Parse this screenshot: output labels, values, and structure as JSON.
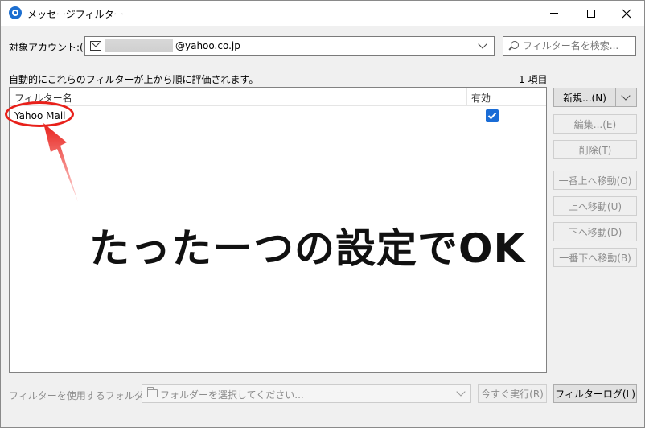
{
  "window": {
    "title": "メッセージフィルター"
  },
  "account": {
    "label": "対象アカウント:(F)",
    "value": "@yahoo.co.jp"
  },
  "search": {
    "placeholder": "フィルター名を検索..."
  },
  "list": {
    "description": "自動的にこれらのフィルターが上から順に評価されます。",
    "count": "1 項目",
    "columns": {
      "name": "フィルター名",
      "enabled": "有効"
    },
    "rows": [
      {
        "name": "Yahoo Mail",
        "enabled": true
      }
    ]
  },
  "buttons": {
    "new": "新規...(N)",
    "edit": "編集...(E)",
    "delete": "削除(T)",
    "move_top": "一番上へ移動(O)",
    "move_up": "上へ移動(U)",
    "move_down": "下へ移動(D)",
    "move_bottom": "一番下へ移動(B)",
    "run_now": "今すぐ実行(R)",
    "filter_log": "フィルターログ(L)"
  },
  "footer": {
    "folder_label": "フィルターを使用するフォルダー:(C)",
    "folder_placeholder": "フォルダーを選択してください..."
  },
  "annotation": {
    "caption": "たったーつの設定でOK"
  },
  "colors": {
    "accent": "#1a6cd6",
    "annotation": "#e8201a"
  },
  "icons": [
    "app-icon",
    "minimize-icon",
    "maximize-icon",
    "close-icon",
    "mail-account-icon",
    "chevron-down-icon",
    "search-icon",
    "checkmark-icon",
    "folder-icon"
  ]
}
